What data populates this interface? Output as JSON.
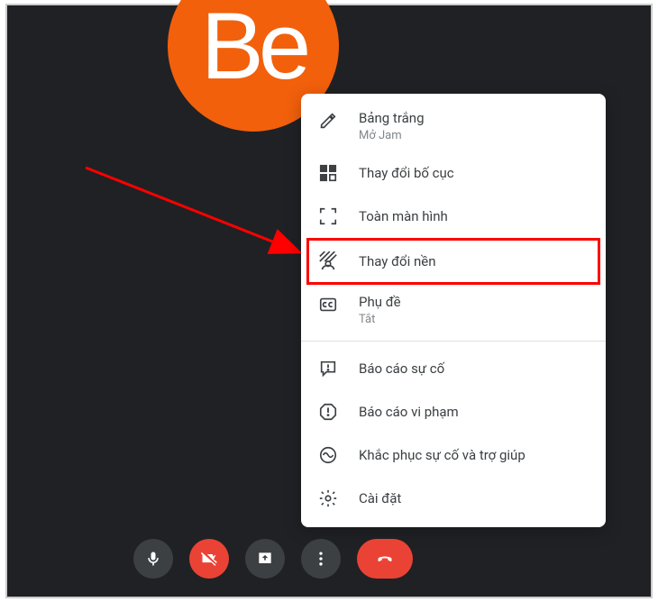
{
  "avatar": {
    "initials": "Be"
  },
  "menu": {
    "whiteboard": {
      "label": "Bảng trắng",
      "sub": "Mở Jam"
    },
    "change_layout": {
      "label": "Thay đổi bố cục"
    },
    "fullscreen": {
      "label": "Toàn màn hình"
    },
    "change_background": {
      "label": "Thay đổi nền"
    },
    "captions": {
      "label": "Phụ đề",
      "sub": "Tắt"
    },
    "report_problem": {
      "label": "Báo cáo sự cố"
    },
    "report_abuse": {
      "label": "Báo cáo vi phạm"
    },
    "troubleshoot": {
      "label": "Khắc phục sự cố và trợ giúp"
    },
    "settings": {
      "label": "Cài đặt"
    }
  }
}
